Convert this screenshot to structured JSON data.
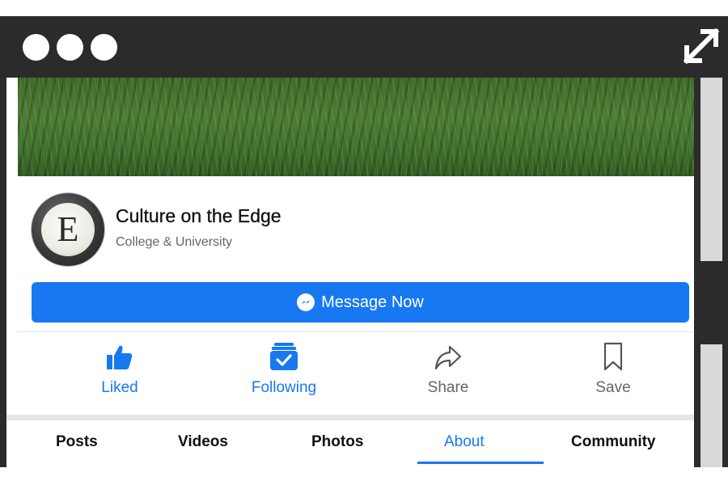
{
  "window": {
    "dots": [
      "window-dot-1",
      "window-dot-2",
      "window-dot-3"
    ]
  },
  "page": {
    "name": "Culture on the Edge",
    "category": "College & University",
    "avatar_letter": "E"
  },
  "message_button": {
    "label": "Message Now"
  },
  "actions": [
    {
      "label": "Liked",
      "icon": "thumbs-up-icon",
      "color": "#1778f2"
    },
    {
      "label": "Following",
      "icon": "following-inbox-icon",
      "color": "#1778f2"
    },
    {
      "label": "Share",
      "icon": "share-arrow-icon",
      "color": "#666666"
    },
    {
      "label": "Save",
      "icon": "bookmark-icon",
      "color": "#666666"
    }
  ],
  "tabs": [
    {
      "label": "Posts"
    },
    {
      "label": "Videos"
    },
    {
      "label": "Photos"
    },
    {
      "label": "About",
      "active": true
    },
    {
      "label": "Community"
    }
  ],
  "colors": {
    "accent": "#1778f2",
    "chrome": "#2b2b2b"
  }
}
